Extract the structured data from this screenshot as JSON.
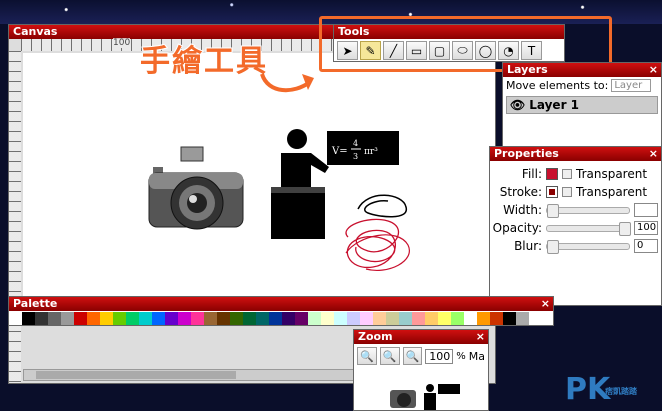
{
  "canvas": {
    "title": "Canvas",
    "close": "×",
    "ruler_label": "100"
  },
  "tools": {
    "title": "Tools",
    "items": [
      {
        "name": "select-tool",
        "glyph": "➤"
      },
      {
        "name": "pencil-tool",
        "glyph": "✎"
      },
      {
        "name": "line-tool",
        "glyph": "╱"
      },
      {
        "name": "rect-tool",
        "glyph": "▭"
      },
      {
        "name": "square-tool",
        "glyph": "▢"
      },
      {
        "name": "ellipse-tool",
        "glyph": "⬭"
      },
      {
        "name": "circle-tool",
        "glyph": "◯"
      },
      {
        "name": "path-tool",
        "glyph": "◔"
      },
      {
        "name": "text-tool",
        "glyph": "T"
      }
    ]
  },
  "annotation": "手繪工具",
  "formula": {
    "lhs": "V=",
    "num": "4",
    "den": "3",
    "rhs": "πr³"
  },
  "layers": {
    "title": "Layers",
    "close": "×",
    "move_label": "Move elements to:",
    "move_value": "Layer",
    "layer_name": "Layer 1"
  },
  "properties": {
    "title": "Properties",
    "close": "×",
    "fill_label": "Fill:",
    "stroke_label": "Stroke:",
    "transparent": "Transparent",
    "width_label": "Width:",
    "opacity_label": "Opacity:",
    "blur_label": "Blur:",
    "opacity_value": "100",
    "blur_value": "0",
    "fill_color": "#c8102e",
    "stroke_color": "#8a0000"
  },
  "palette": {
    "title": "Palette",
    "close": "×",
    "colors": [
      "#ffffff",
      "#000000",
      "#333333",
      "#666666",
      "#999999",
      "#cc0000",
      "#ff6600",
      "#ffcc00",
      "#66cc00",
      "#00cc66",
      "#00cccc",
      "#0066ff",
      "#6600cc",
      "#cc00cc",
      "#ff3399",
      "#996633",
      "#663300",
      "#336600",
      "#006633",
      "#006666",
      "#003399",
      "#330066",
      "#660066",
      "#ccffcc",
      "#ffffcc",
      "#ccffff",
      "#ccccff",
      "#ffccff",
      "#ffcc99",
      "#cccc99",
      "#99cccc",
      "#ff9999",
      "#ffcc66",
      "#ffff66",
      "#99ff66",
      "#ffffff",
      "#ff9900",
      "#cc3300",
      "#000000",
      "#aaaaaa"
    ]
  },
  "zoom": {
    "title": "Zoom",
    "close": "×",
    "value": "100",
    "unit": "%",
    "suffix": "Ma"
  },
  "watermark": {
    "text": "PK",
    "sub": "痞凱踏踏"
  }
}
